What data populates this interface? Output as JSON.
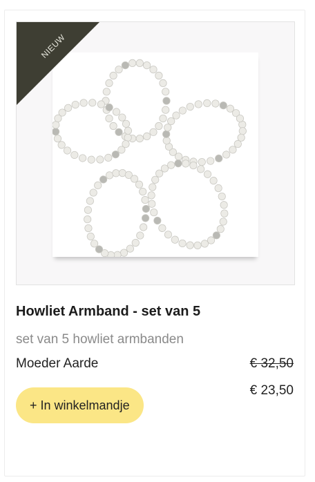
{
  "product": {
    "badge": "NIEUW",
    "title": "Howliet Armband - set van 5",
    "subtitle": "set van 5 howliet armbanden",
    "brand": "Moeder Aarde",
    "old_price": "€ 32,50",
    "new_price": "€ 23,50",
    "add_to_cart_label": "+ In winkelmandje",
    "image": "howlite-bracelets-photo"
  },
  "colors": {
    "ribbon": "#3e3e33",
    "button": "#fbe686",
    "subtitle_text": "#8a8a8a"
  }
}
